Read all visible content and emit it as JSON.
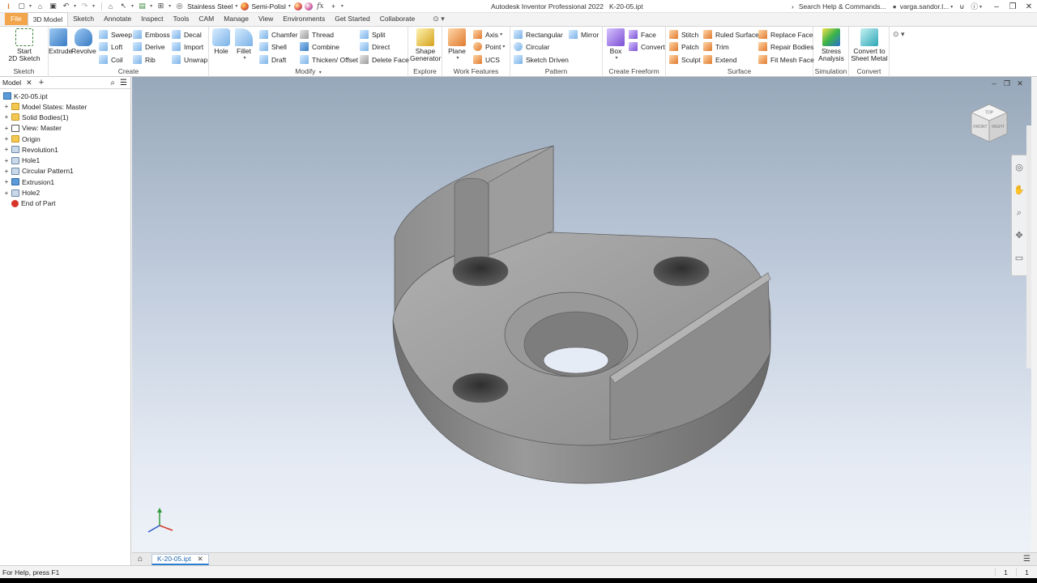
{
  "qat": {
    "material": "Stainless Steel",
    "appearance": "Semi-Polisl",
    "fx_icon": "fx"
  },
  "title": {
    "app": "Autodesk Inventor Professional 2022",
    "document": "K-20-05.ipt",
    "search": "Search Help & Commands...",
    "user": "varga.sandor.l..."
  },
  "tabs": [
    "File",
    "3D Model",
    "Sketch",
    "Annotate",
    "Inspect",
    "Tools",
    "CAM",
    "Manage",
    "View",
    "Environments",
    "Get Started",
    "Collaborate"
  ],
  "ribbon": {
    "sketch": {
      "label": "Sketch",
      "start_sketch_1": "Start",
      "start_sketch_2": "2D Sketch"
    },
    "create": {
      "label": "Create",
      "extrude": "Extrude",
      "revolve": "Revolve",
      "sweep": "Sweep",
      "loft": "Loft",
      "coil": "Coil",
      "emboss": "Emboss",
      "derive": "Derive",
      "rib": "Rib",
      "decal": "Decal",
      "import": "Import",
      "unwrap": "Unwrap"
    },
    "modify": {
      "label": "Modify",
      "hole": "Hole",
      "fillet": "Fillet",
      "chamfer": "Chamfer",
      "shell": "Shell",
      "draft": "Draft",
      "thread": "Thread",
      "combine": "Combine",
      "thicken": "Thicken/ Offset",
      "split": "Split",
      "direct": "Direct",
      "delete_face": "Delete Face"
    },
    "explore": {
      "label": "Explore",
      "shape_generator_1": "Shape",
      "shape_generator_2": "Generator"
    },
    "work_features": {
      "label": "Work Features",
      "plane": "Plane",
      "axis": "Axis",
      "point": "Point",
      "ucs": "UCS"
    },
    "pattern": {
      "label": "Pattern",
      "rectangular": "Rectangular",
      "circular": "Circular",
      "sketch_driven": "Sketch Driven",
      "mirror": "Mirror"
    },
    "create_freeform": {
      "label": "Create Freeform",
      "box": "Box",
      "face": "Face",
      "convert": "Convert"
    },
    "surface": {
      "label": "Surface",
      "stitch": "Stitch",
      "patch": "Patch",
      "sculpt": "Sculpt",
      "ruled_surface": "Ruled Surface",
      "trim": "Trim",
      "extend": "Extend",
      "replace_face": "Replace Face",
      "repair_bodies": "Repair Bodies",
      "fit_mesh_face": "Fit Mesh Face"
    },
    "simulation": {
      "label": "Simulation",
      "stress_1": "Stress",
      "stress_2": "Analysis"
    },
    "convert": {
      "label": "Convert",
      "sheet_1": "Convert to",
      "sheet_2": "Sheet Metal"
    }
  },
  "browser": {
    "tab": "Model",
    "root": "K-20-05.ipt",
    "items": [
      {
        "label": "Model States: Master",
        "icon": "folder"
      },
      {
        "label": "Solid Bodies(1)",
        "icon": "folder"
      },
      {
        "label": "View: Master",
        "icon": "view"
      },
      {
        "label": "Origin",
        "icon": "folder"
      },
      {
        "label": "Revolution1",
        "icon": "feat"
      },
      {
        "label": "Hole1",
        "icon": "feat"
      },
      {
        "label": "Circular Pattern1",
        "icon": "feat"
      },
      {
        "label": "Extrusion1",
        "icon": "part"
      },
      {
        "label": "Hole2",
        "icon": "feat"
      },
      {
        "label": "End of Part",
        "icon": "end"
      }
    ]
  },
  "viewcube": {
    "top": "TOP",
    "front": "FRONT",
    "right": "RIGHT"
  },
  "doctab": {
    "name": "K-20-05.ipt"
  },
  "status": {
    "help": "For Help, press F1",
    "count_1": "1",
    "count_2": "1"
  },
  "colors": {
    "file_tab": "#f2a54a",
    "active_doc": "#2d80d0",
    "part_body": "#8c8c8c"
  }
}
